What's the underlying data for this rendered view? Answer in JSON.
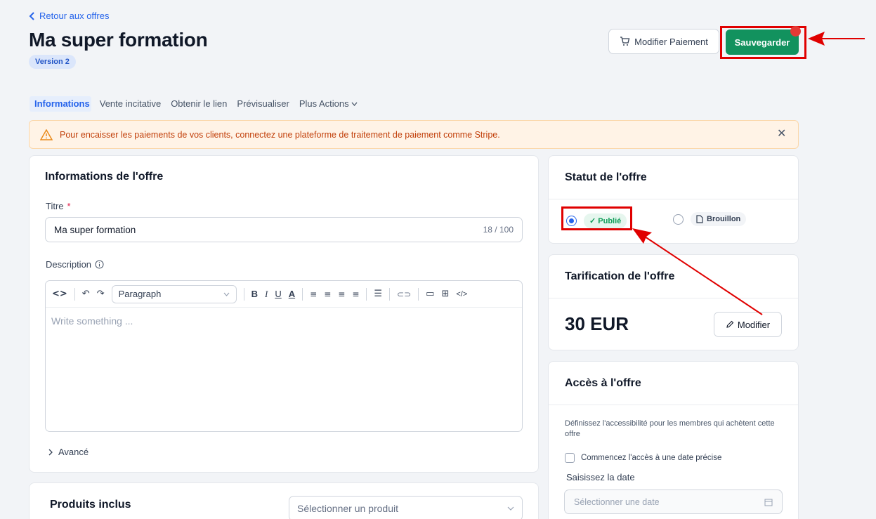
{
  "header": {
    "back_label": "Retour aux offres",
    "title": "Ma super formation",
    "version": "Version 2",
    "pay_button": "Modifier Paiement",
    "save_button": "Sauvegarder"
  },
  "tabs": [
    {
      "label": "Informations",
      "active": true
    },
    {
      "label": "Vente incitative"
    },
    {
      "label": "Obtenir le lien"
    },
    {
      "label": "Prévisualiser"
    },
    {
      "label": "Plus Actions"
    }
  ],
  "alert": {
    "text": "Pour encaisser les paiements de vos clients, connectez une plateforme de traitement de paiement comme Stripe."
  },
  "info_card": {
    "title": "Informations de l'offre",
    "titre_label": "Titre",
    "required_mark": "*",
    "titre_value": "Ma super formation",
    "titre_counter": "18 / 100",
    "description_label": "Description",
    "editor_style": "Paragraph",
    "editor_placeholder": "Write something ...",
    "advanced_label": "Avancé"
  },
  "products_card": {
    "title": "Produits inclus",
    "select_placeholder": "Sélectionner un produit"
  },
  "status_card": {
    "title": "Statut de l'offre",
    "published_label": "Publié",
    "draft_label": "Brouillon",
    "selected": "published"
  },
  "pricing_card": {
    "title": "Tarification de l'offre",
    "price": "30 EUR",
    "edit_button": "Modifier"
  },
  "access_card": {
    "title": "Accès à l'offre",
    "description": "Définissez l'accessibilité pour les membres qui achètent cette offre",
    "checkbox_label": "Commencez l'accès à une date précise",
    "date_label": "Saisissez la date",
    "date_placeholder": "Sélectionner une date"
  },
  "colors": {
    "accent": "#2563eb",
    "save_green": "#12925e",
    "annotation_red": "#e00000",
    "alert_text": "#c2410c"
  }
}
